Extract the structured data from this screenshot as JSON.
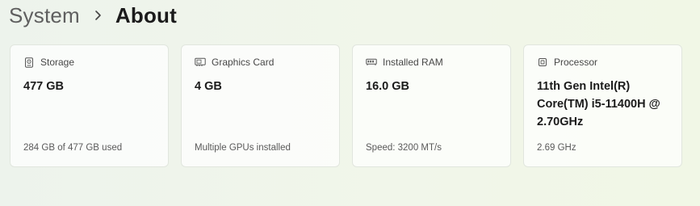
{
  "breadcrumb": {
    "parent": "System",
    "current": "About"
  },
  "cards": [
    {
      "title": "Storage",
      "icon": "storage-icon",
      "value": "477 GB",
      "subtitle": "284 GB of 477 GB used"
    },
    {
      "title": "Graphics Card",
      "icon": "graphics-card-icon",
      "value": "4 GB",
      "subtitle": "Multiple GPUs installed"
    },
    {
      "title": "Installed RAM",
      "icon": "ram-icon",
      "value": "16.0 GB",
      "subtitle": "Speed: 3200 MT/s"
    },
    {
      "title": "Processor",
      "icon": "processor-icon",
      "value": "11th Gen Intel(R) Core(TM) i5-11400H @ 2.70GHz",
      "subtitle": "2.69 GHz"
    }
  ]
}
